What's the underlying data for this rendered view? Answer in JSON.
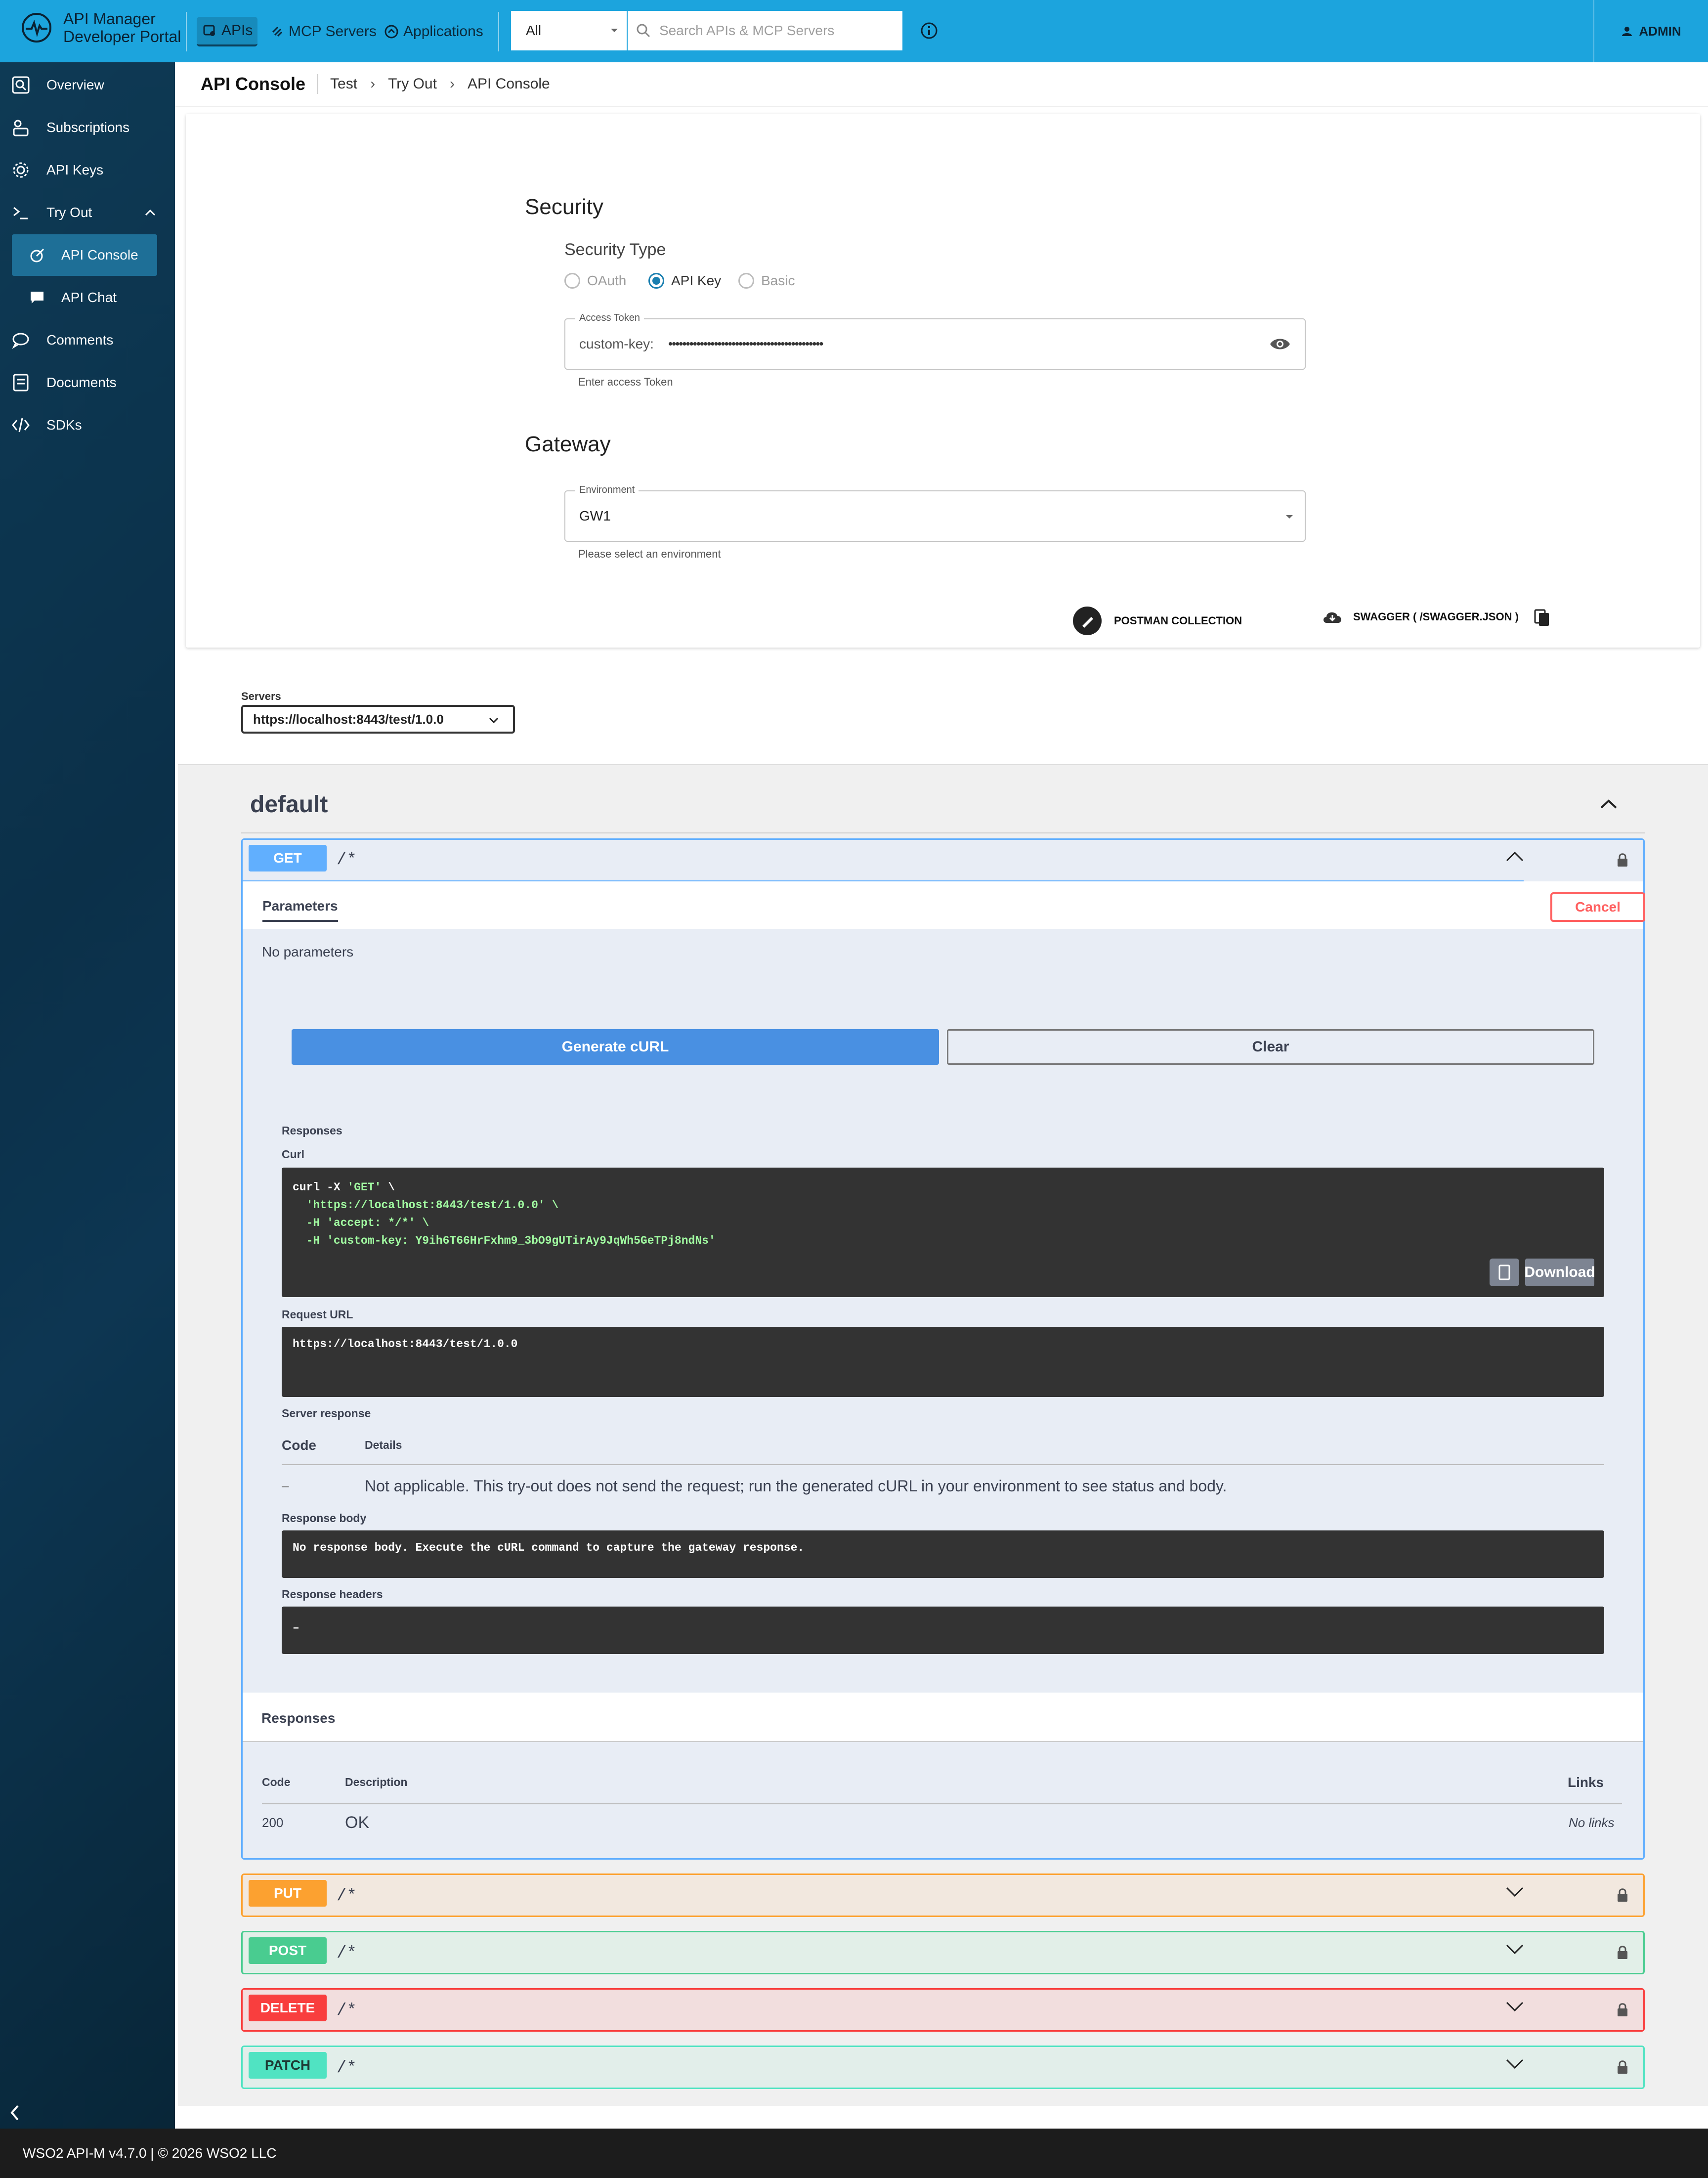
{
  "header": {
    "logo_line1": "API Manager",
    "logo_line2": "Developer Portal",
    "nav": [
      {
        "label": "APIs"
      },
      {
        "label": "MCP Servers"
      },
      {
        "label": "Applications"
      }
    ],
    "filter_value": "All",
    "search_placeholder": "Search APIs & MCP Servers",
    "user": "ADMIN"
  },
  "sidebar": {
    "items": [
      {
        "label": "Overview",
        "icon": "overview-icon"
      },
      {
        "label": "Subscriptions",
        "icon": "subscriptions-icon"
      },
      {
        "label": "API Keys",
        "icon": "gear-icon"
      },
      {
        "label": "Try Out",
        "icon": "terminal-icon"
      },
      {
        "label": "API Console",
        "icon": "console-icon"
      },
      {
        "label": "API Chat",
        "icon": "chat-icon"
      },
      {
        "label": "Comments",
        "icon": "comment-icon"
      },
      {
        "label": "Documents",
        "icon": "document-icon"
      },
      {
        "label": "SDKs",
        "icon": "code-icon"
      }
    ]
  },
  "breadcrumb": {
    "title": "API Console",
    "items": [
      "Test",
      "Try Out",
      "API Console"
    ]
  },
  "security": {
    "heading": "Security",
    "type_label": "Security Type",
    "options": [
      "OAuth",
      "API Key",
      "Basic"
    ],
    "selected": "API Key",
    "token_label": "Access Token",
    "token_prefix": "custom-key:",
    "token_masked": "••••••••••••••••••••••••••••••••••••••••••••",
    "token_helper": "Enter access Token"
  },
  "gateway": {
    "heading": "Gateway",
    "env_label": "Environment",
    "env_value": "GW1",
    "env_helper": "Please select an environment"
  },
  "actions": {
    "postman": "POSTMAN COLLECTION",
    "swagger": "SWAGGER ( /SWAGGER.JSON )"
  },
  "servers": {
    "label": "Servers",
    "value": "https://localhost:8443/test/1.0.0"
  },
  "swagger": {
    "tag": "default",
    "get": {
      "method": "GET",
      "path": "/*",
      "tab": "Parameters",
      "cancel": "Cancel",
      "no_params": "No parameters",
      "generate": "Generate cURL",
      "clear": "Clear",
      "responses_label": "Responses",
      "curl_label": "Curl",
      "curl_lines": [
        "curl -X 'GET' \\",
        "  'https://localhost:8443/test/1.0.0' \\",
        "  -H 'accept: */*' \\",
        "  -H 'custom-key: Y9ih6T66HrFxhm9_3bO9gUTirAy9JqWh5GeTPj8ndNs'"
      ],
      "download": "Download",
      "request_url_label": "Request URL",
      "request_url": "https://localhost:8443/test/1.0.0",
      "server_response_label": "Server response",
      "code_h": "Code",
      "details_h": "Details",
      "resp_code": "–",
      "resp_details": "Not applicable. This try-out does not send the request; run the generated cURL in your environment to see status and body.",
      "resp_body_label": "Response body",
      "resp_body": "No response body. Execute the cURL command to capture the gateway response.",
      "resp_headers_label": "Response headers",
      "resp_headers": "–",
      "responses_section": "Responses",
      "table_code": "Code",
      "table_desc": "Description",
      "table_links": "Links",
      "row_code": "200",
      "row_desc": "OK",
      "row_links": "No links"
    },
    "others": [
      {
        "method": "PUT",
        "path": "/*",
        "color": "#fca130",
        "bg": "#f2e8df"
      },
      {
        "method": "POST",
        "path": "/*",
        "color": "#49cc90",
        "bg": "#e2efe8"
      },
      {
        "method": "DELETE",
        "path": "/*",
        "color": "#f93e3e",
        "bg": "#f2dede"
      },
      {
        "method": "PATCH",
        "path": "/*",
        "color": "#50e3c2",
        "bg": "#e2eeea"
      }
    ]
  },
  "footer": "WSO2 API-M v4.7.0 | © 2026 WSO2 LLC"
}
